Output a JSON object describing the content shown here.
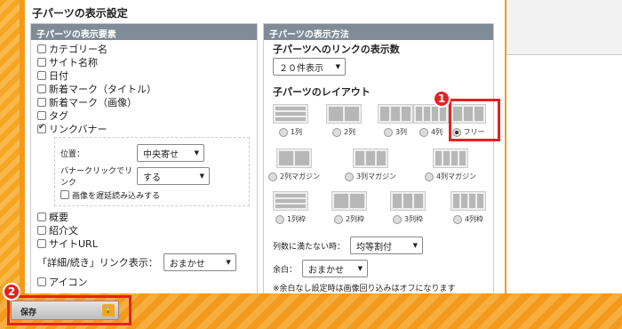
{
  "title": "子パーツの表示設定",
  "left": {
    "header": "子パーツの表示要素",
    "items1": [
      {
        "label": "カテゴリー名",
        "checked": false
      },
      {
        "label": "サイト名称",
        "checked": false
      },
      {
        "label": "日付",
        "checked": false
      },
      {
        "label": "新着マーク（タイトル）",
        "checked": false
      },
      {
        "label": "新着マーク（画像）",
        "checked": false
      },
      {
        "label": "タグ",
        "checked": false
      },
      {
        "label": "リンクバナー",
        "checked": true
      }
    ],
    "sub": {
      "position_label": "位置：",
      "position_value": "中央寄せ",
      "banner_label": "バナークリックでリンク",
      "banner_value": "する",
      "lazy_label": "画像を遅延読み込みする"
    },
    "items2": [
      {
        "label": "概要",
        "checked": false
      },
      {
        "label": "紹介文",
        "checked": false
      },
      {
        "label": "サイトURL",
        "checked": false
      }
    ],
    "detail_label": "「詳細/続き」リンク表示：",
    "detail_value": "おまかせ",
    "icon_label": "アイコン"
  },
  "right": {
    "header": "子パーツの表示方法",
    "count_label": "子パーツへのリンクの表示数",
    "count_value": "２０件表示",
    "layout_label": "子パーツのレイアウト",
    "layouts": [
      {
        "label": "1列",
        "cols": 1,
        "rows": 3,
        "selected": false
      },
      {
        "label": "2列",
        "cols": 2,
        "rows": 1,
        "selected": false
      },
      {
        "label": "3列",
        "cols": 3,
        "rows": 1,
        "selected": false
      },
      {
        "label": "4列",
        "cols": 4,
        "rows": 1,
        "selected": false
      },
      {
        "label": "フリー",
        "cols": 3,
        "rows": 1,
        "selected": true
      },
      {
        "label": "2列マガジン",
        "cols": 2,
        "rows": 2,
        "selected": false
      },
      {
        "label": "3列マガジン",
        "cols": 3,
        "rows": 2,
        "selected": false
      },
      {
        "label": "4列マガジン",
        "cols": 4,
        "rows": 2,
        "selected": false
      },
      {
        "label": "1列枠",
        "cols": 1,
        "rows": 3,
        "selected": false
      },
      {
        "label": "2列枠",
        "cols": 2,
        "rows": 1,
        "selected": false
      },
      {
        "label": "3列枠",
        "cols": 3,
        "rows": 1,
        "selected": false
      },
      {
        "label": "4列枠",
        "cols": 4,
        "rows": 1,
        "selected": false
      }
    ],
    "short_label": "列数に満たない時：",
    "short_value": "均等割付",
    "margin_label": "余白：",
    "margin_value": "おまかせ",
    "note": "※余白なし設定時は画像回り込みはオフになります"
  },
  "save_label": "保存",
  "badge1": "1",
  "badge2": "2",
  "colors": {
    "accent": "#f39a1c",
    "highlight": "#e32222"
  }
}
